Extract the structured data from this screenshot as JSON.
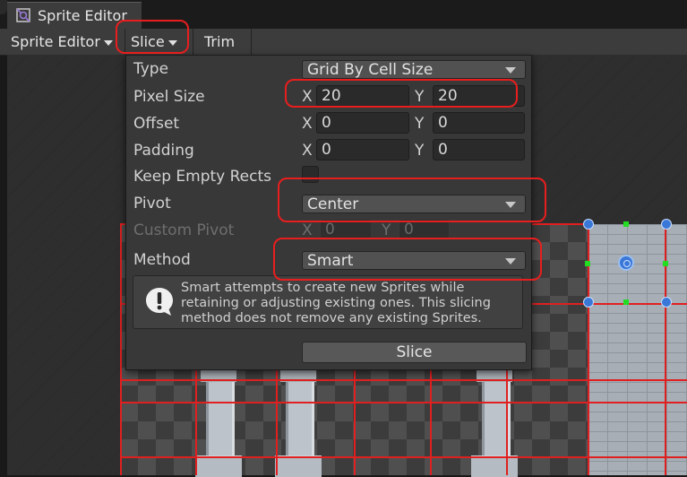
{
  "window": {
    "title": "Sprite Editor",
    "icon": "sprite-editor-icon"
  },
  "toolbar": {
    "mode_label": "Sprite Editor",
    "slice_label": "Slice",
    "trim_label": "Trim"
  },
  "slice_popup": {
    "type": {
      "label": "Type",
      "value": "Grid By Cell Size"
    },
    "pixel_size": {
      "label": "Pixel Size",
      "x_label": "X",
      "x": "20",
      "y_label": "Y",
      "y": "20"
    },
    "offset": {
      "label": "Offset",
      "x_label": "X",
      "x": "0",
      "y_label": "Y",
      "y": "0"
    },
    "padding": {
      "label": "Padding",
      "x_label": "X",
      "x": "0",
      "y_label": "Y",
      "y": "0"
    },
    "keep_empty_rects": {
      "label": "Keep Empty Rects",
      "checked": false
    },
    "pivot": {
      "label": "Pivot",
      "value": "Center"
    },
    "custom_pivot": {
      "label": "Custom Pivot",
      "x_label": "X",
      "x": "0",
      "y_label": "Y",
      "y": "0",
      "enabled": false
    },
    "method": {
      "label": "Method",
      "value": "Smart"
    },
    "help_text": "Smart attempts to create new Sprites while retaining or adjusting existing ones. This slicing method does not remove any existing Sprites.",
    "help_icon": "warning-icon",
    "slice_button_label": "Slice"
  },
  "colors": {
    "highlight": "#e81e1e",
    "sprite_outline": "#e02020",
    "handle_blue": "#3a78d8",
    "handle_green": "#22dd22",
    "panel_bg": "#383838"
  }
}
